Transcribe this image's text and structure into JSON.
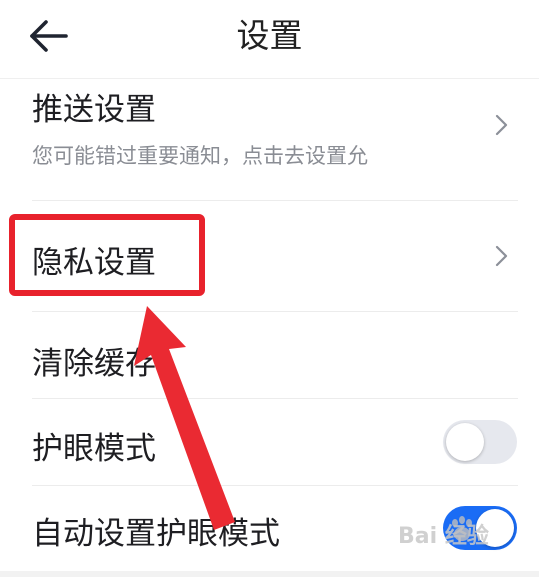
{
  "header": {
    "title": "设置",
    "back_icon": "arrow-left-icon"
  },
  "settings": {
    "push": {
      "title": "推送设置",
      "subtitle": "您可能错过重要通知，点击去设置允"
    },
    "privacy": {
      "title": "隐私设置"
    },
    "clear_cache": {
      "title": "清除缓存"
    },
    "eye_care": {
      "title": "护眼模式",
      "enabled": false
    },
    "auto_eye_care": {
      "title": "自动设置护眼模式",
      "enabled": true
    }
  },
  "watermark": {
    "text": "Bai 经验"
  },
  "colors": {
    "accent_blue": "#1a6cf5",
    "toggle_off": "#e6e8ee",
    "highlight_red": "#e8222c",
    "divider": "#ececec",
    "subtitle": "#8a8d94"
  }
}
